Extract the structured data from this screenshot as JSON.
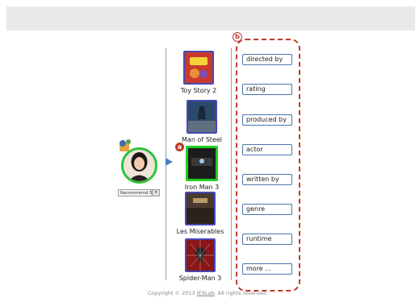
{
  "user": {
    "recommend_select": "Recommend 5 m",
    "select_arrow": "▾"
  },
  "markers": {
    "a": "a",
    "b": "b"
  },
  "movies": [
    {
      "title": "Toy Story 2",
      "poster_color": "#d8322a"
    },
    {
      "title": "Man of Steel",
      "poster_color": "#2b4a6b"
    },
    {
      "title": "Iron Man 3",
      "poster_color": "#1c1c1c",
      "selected": true
    },
    {
      "title": "Les Miserables",
      "poster_color": "#4a3a2e"
    },
    {
      "title": "Spider-Man 3",
      "poster_color": "#8a1616"
    }
  ],
  "attributes": [
    "directed by",
    "rating",
    "produced by",
    "actor",
    "written by",
    "genre",
    "runtime",
    "more ..."
  ],
  "footer": {
    "prefix": "Copyright © 2013 ",
    "link": "IESLab",
    "suffix": ". All rights reserved."
  },
  "colors": {
    "accent_blue": "#4a74b0",
    "selection_green": "#22cc22",
    "marker_red": "#c0392b"
  }
}
